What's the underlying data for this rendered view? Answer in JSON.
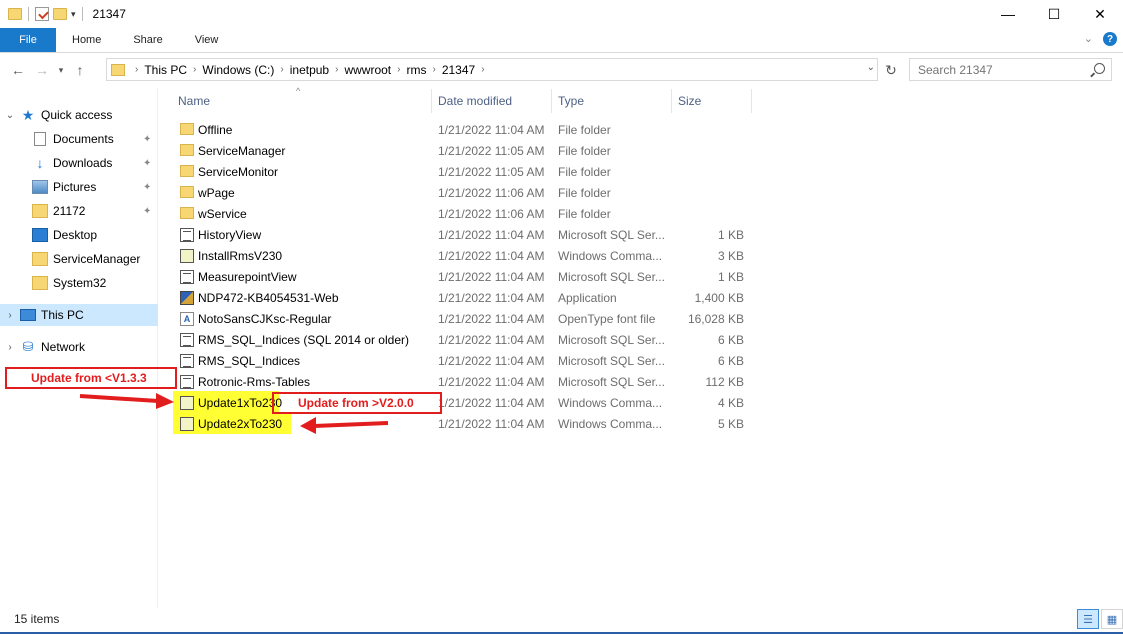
{
  "window": {
    "title": "21347",
    "controls": {
      "minimize": "—",
      "maximize": "☐",
      "close": "✕"
    }
  },
  "ribbon": {
    "tabs": [
      "File",
      "Home",
      "Share",
      "View"
    ],
    "help": "?"
  },
  "address": {
    "crumbs": [
      "This PC",
      "Windows (C:)",
      "inetpub",
      "wwwroot",
      "rms",
      "21347"
    ],
    "search_placeholder": "Search 21347"
  },
  "nav": {
    "items": [
      {
        "label": "Quick access",
        "icon": "star-icon",
        "pinned": false,
        "expanded": true
      },
      {
        "label": "Documents",
        "icon": "documents-icon",
        "pinned": true
      },
      {
        "label": "Downloads",
        "icon": "downloads-icon",
        "pinned": true
      },
      {
        "label": "Pictures",
        "icon": "pictures-icon",
        "pinned": true
      },
      {
        "label": "21172",
        "icon": "folder-icon",
        "pinned": true
      },
      {
        "label": "Desktop",
        "icon": "desktop-icon",
        "pinned": false
      },
      {
        "label": "ServiceManager",
        "icon": "folder-icon",
        "pinned": false
      },
      {
        "label": "System32",
        "icon": "folder-icon",
        "pinned": false
      },
      {
        "label": "This PC",
        "icon": "computer-icon",
        "selected": true
      },
      {
        "label": "Network",
        "icon": "network-icon"
      }
    ]
  },
  "columns": {
    "name": "Name",
    "date": "Date modified",
    "type": "Type",
    "size": "Size"
  },
  "files": [
    {
      "name": "Offline",
      "date": "1/21/2022 11:04 AM",
      "type": "File folder",
      "size": "",
      "icon": "folder"
    },
    {
      "name": "ServiceManager",
      "date": "1/21/2022 11:05 AM",
      "type": "File folder",
      "size": "",
      "icon": "folder"
    },
    {
      "name": "ServiceMonitor",
      "date": "1/21/2022 11:05 AM",
      "type": "File folder",
      "size": "",
      "icon": "folder"
    },
    {
      "name": "wPage",
      "date": "1/21/2022 11:06 AM",
      "type": "File folder",
      "size": "",
      "icon": "folder"
    },
    {
      "name": "wService",
      "date": "1/21/2022 11:06 AM",
      "type": "File folder",
      "size": "",
      "icon": "folder"
    },
    {
      "name": "HistoryView",
      "date": "1/21/2022 11:04 AM",
      "type": "Microsoft SQL Ser...",
      "size": "1 KB",
      "icon": "sql"
    },
    {
      "name": "InstallRmsV230",
      "date": "1/21/2022 11:04 AM",
      "type": "Windows Comma...",
      "size": "3 KB",
      "icon": "cmd"
    },
    {
      "name": "MeasurepointView",
      "date": "1/21/2022 11:04 AM",
      "type": "Microsoft SQL Ser...",
      "size": "1 KB",
      "icon": "sql"
    },
    {
      "name": "NDP472-KB4054531-Web",
      "date": "1/21/2022 11:04 AM",
      "type": "Application",
      "size": "1,400 KB",
      "icon": "app"
    },
    {
      "name": "NotoSansCJKsc-Regular",
      "date": "1/21/2022 11:04 AM",
      "type": "OpenType font file",
      "size": "16,028 KB",
      "icon": "font"
    },
    {
      "name": "RMS_SQL_Indices (SQL 2014 or older)",
      "date": "1/21/2022 11:04 AM",
      "type": "Microsoft SQL Ser...",
      "size": "6 KB",
      "icon": "sql"
    },
    {
      "name": "RMS_SQL_Indices",
      "date": "1/21/2022 11:04 AM",
      "type": "Microsoft SQL Ser...",
      "size": "6 KB",
      "icon": "sql"
    },
    {
      "name": "Rotronic-Rms-Tables",
      "date": "1/21/2022 11:04 AM",
      "type": "Microsoft SQL Ser...",
      "size": "112 KB",
      "icon": "sql"
    },
    {
      "name": "Update1xTo230",
      "date": "1/21/2022 11:04 AM",
      "type": "Windows Comma...",
      "size": "4 KB",
      "icon": "cmd",
      "highlight": true
    },
    {
      "name": "Update2xTo230",
      "date": "1/21/2022 11:04 AM",
      "type": "Windows Comma...",
      "size": "5 KB",
      "icon": "cmd",
      "highlight": true
    }
  ],
  "annotations": {
    "left": "Update from <V1.3.3",
    "middle": "Update from >V2.0.0",
    "color": "#e21d1d",
    "highlight_color": "#ffff33"
  },
  "status": {
    "items": "15 items"
  }
}
